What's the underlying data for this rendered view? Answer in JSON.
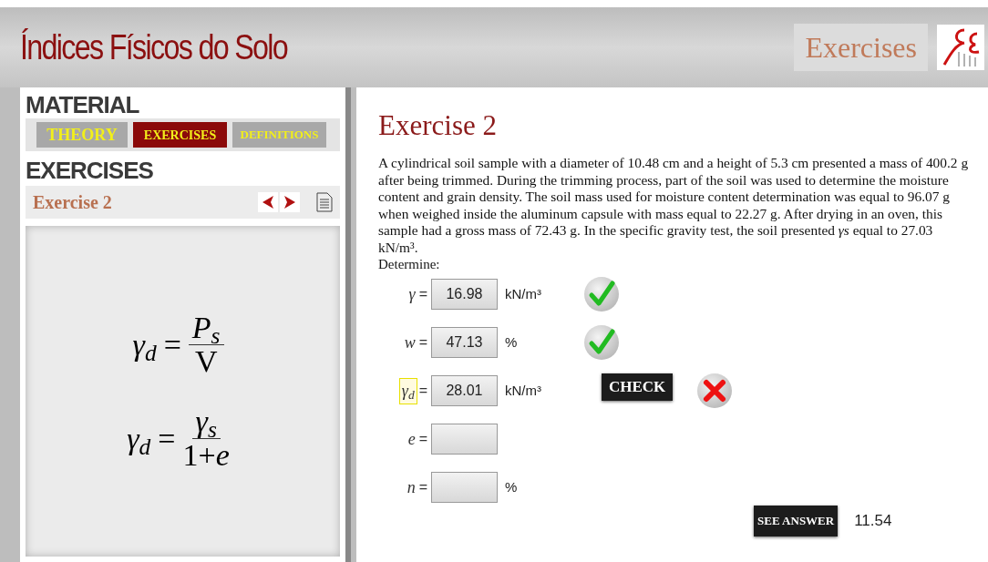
{
  "header": {
    "title": "Índices Físicos do Solo",
    "section": "Exercises"
  },
  "sidebar": {
    "material_heading": "MATERIAL",
    "tabs": [
      {
        "label": "THEORY",
        "selected": false
      },
      {
        "label": "EXERCISES",
        "selected": true
      },
      {
        "label": "DEFINITIONS",
        "selected": false
      }
    ],
    "exercises_heading": "EXERCISES",
    "current_exercise": "Exercise 2",
    "formulas": [
      {
        "lhs": "γ$_{d}$",
        "equals": "=",
        "numerator": "P$_{s}$",
        "denominator": "V"
      },
      {
        "lhs": "γ$_{d}$",
        "equals": "=",
        "numerator": "γ$_{s}$",
        "denominator": "1+*e*"
      }
    ]
  },
  "exercise": {
    "title": "Exercise 2",
    "statement": "A cylindrical soil sample with a diameter of 10.48 cm and a height of 5.3 cm presented a mass of 400.2 g  after being trimmed. During the trimming process, part of the soil was used to determine the moisture content and grain density. The soil mass used for moisture content determination was equal to 96.07 g when weighed inside the aluminum capsule with mass equal to 22.27 g. After drying in an oven, this sample had a gross mass of 72.43 g. In the specific gravity test, the soil presented *γs* equal to 27.03 kN/m³.",
    "prompt": "Determine:",
    "fields": [
      {
        "label": "γ",
        "equals": "=",
        "value": "16.98",
        "unit": "kN/m³",
        "checked": true,
        "correct": true,
        "focused": false
      },
      {
        "label": "w",
        "equals": "=",
        "value": "47.13",
        "unit": "%",
        "checked": true,
        "correct": true,
        "focused": false
      },
      {
        "label": "γ$_{d}$",
        "equals": "=",
        "value": "28.01",
        "unit": "kN/m³",
        "checked": true,
        "correct": false,
        "focused": true,
        "check_button": "CHECK"
      },
      {
        "label": "e",
        "equals": "=",
        "checked": false,
        "focused": false
      },
      {
        "label": "n",
        "equals": "=",
        "unit": "%",
        "checked": false,
        "focused": false
      }
    ],
    "see_answer_button": "SEE ANSWER",
    "answer": "11.54"
  }
}
